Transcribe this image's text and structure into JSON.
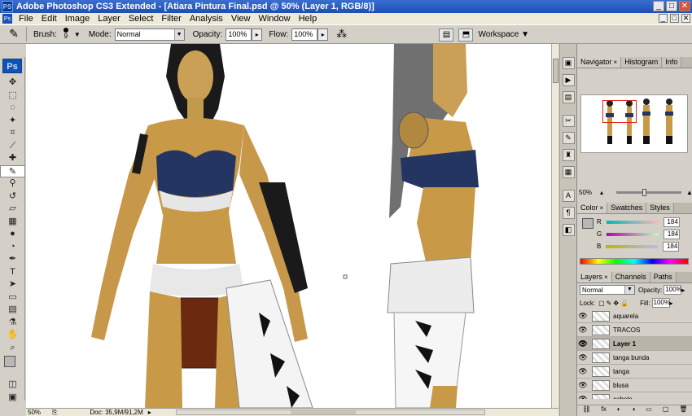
{
  "window": {
    "app_logo": "PS",
    "title": "Adobe Photoshop CS3 Extended - [Atiara Pintura Final.psd @ 50% (Layer 1, RGB/8)]",
    "buttons": [
      "_",
      "□",
      "✕"
    ]
  },
  "menu": {
    "doc_icon": "Ps",
    "items": [
      "File",
      "Edit",
      "Image",
      "Layer",
      "Select",
      "Filter",
      "Analysis",
      "View",
      "Window",
      "Help"
    ],
    "doc_buttons": [
      "_",
      "□",
      "✕"
    ]
  },
  "options": {
    "brush_label": "Brush:",
    "brush_size": "9",
    "mode_label": "Mode:",
    "mode_value": "Normal",
    "opacity_label": "Opacity:",
    "opacity_value": "100%",
    "flow_label": "Flow:",
    "flow_value": "100%",
    "workspace_label": "Workspace ▼"
  },
  "toolbox": {
    "logo": "Ps",
    "tools": [
      {
        "name": "move-tool",
        "glyph": "✥"
      },
      {
        "name": "marquee-tool",
        "glyph": "⬚"
      },
      {
        "name": "lasso-tool",
        "glyph": "◌"
      },
      {
        "name": "magic-wand-tool",
        "glyph": "✦"
      },
      {
        "name": "crop-tool",
        "glyph": "⌗"
      },
      {
        "name": "slice-tool",
        "glyph": "⟋"
      },
      {
        "name": "healing-brush-tool",
        "glyph": "✚"
      },
      {
        "name": "brush-tool",
        "glyph": "✎"
      },
      {
        "name": "clone-stamp-tool",
        "glyph": "⚲"
      },
      {
        "name": "history-brush-tool",
        "glyph": "↺"
      },
      {
        "name": "eraser-tool",
        "glyph": "▱"
      },
      {
        "name": "gradient-tool",
        "glyph": "▦"
      },
      {
        "name": "blur-tool",
        "glyph": "●"
      },
      {
        "name": "dodge-tool",
        "glyph": "◔"
      },
      {
        "name": "pen-tool",
        "glyph": "✒"
      },
      {
        "name": "type-tool",
        "glyph": "T"
      },
      {
        "name": "path-selection-tool",
        "glyph": "➤"
      },
      {
        "name": "shape-tool",
        "glyph": "▭"
      },
      {
        "name": "notes-tool",
        "glyph": "▤"
      },
      {
        "name": "eyedropper-tool",
        "glyph": "⚗"
      },
      {
        "name": "hand-tool",
        "glyph": "✋"
      },
      {
        "name": "zoom-tool",
        "glyph": "⌕"
      }
    ],
    "extra": [
      "◫",
      "▣"
    ]
  },
  "status": {
    "zoom": "50%",
    "doc": "Doc: 35,9M/91,2M"
  },
  "navigator": {
    "tabs": [
      "Navigator",
      "Histogram",
      "Info"
    ],
    "zoom": "50%"
  },
  "color": {
    "tabs": [
      "Color",
      "Swatches",
      "Styles"
    ],
    "channels": [
      {
        "label": "R",
        "value": "184",
        "gradient": "linear-gradient(90deg,#00b8b8,#ffb8b8)"
      },
      {
        "label": "G",
        "value": "184",
        "gradient": "linear-gradient(90deg,#b800b8,#b8ffb8)"
      },
      {
        "label": "B",
        "value": "184",
        "gradient": "linear-gradient(90deg,#b8b800,#b8b8ff)"
      }
    ],
    "foreground": "#b8b8b8"
  },
  "layers": {
    "tabs": [
      "Layers",
      "Channels",
      "Paths"
    ],
    "blend_mode": "Normal",
    "opacity_label": "Opacity:",
    "opacity": "100%",
    "lock_label": "Lock:",
    "fill_label": "Fill:",
    "fill": "100%",
    "items": [
      {
        "name": "aquarela",
        "active": false
      },
      {
        "name": "TRACOS",
        "active": false
      },
      {
        "name": "Layer 1",
        "active": true
      },
      {
        "name": "tanga bunda",
        "active": false
      },
      {
        "name": "tanga",
        "active": false
      },
      {
        "name": "blusa",
        "active": false
      },
      {
        "name": "cabelo",
        "active": false
      }
    ],
    "footer_icons": [
      "⛓",
      "fx",
      "◐",
      "◑",
      "▭",
      "▢",
      "🗑"
    ]
  }
}
